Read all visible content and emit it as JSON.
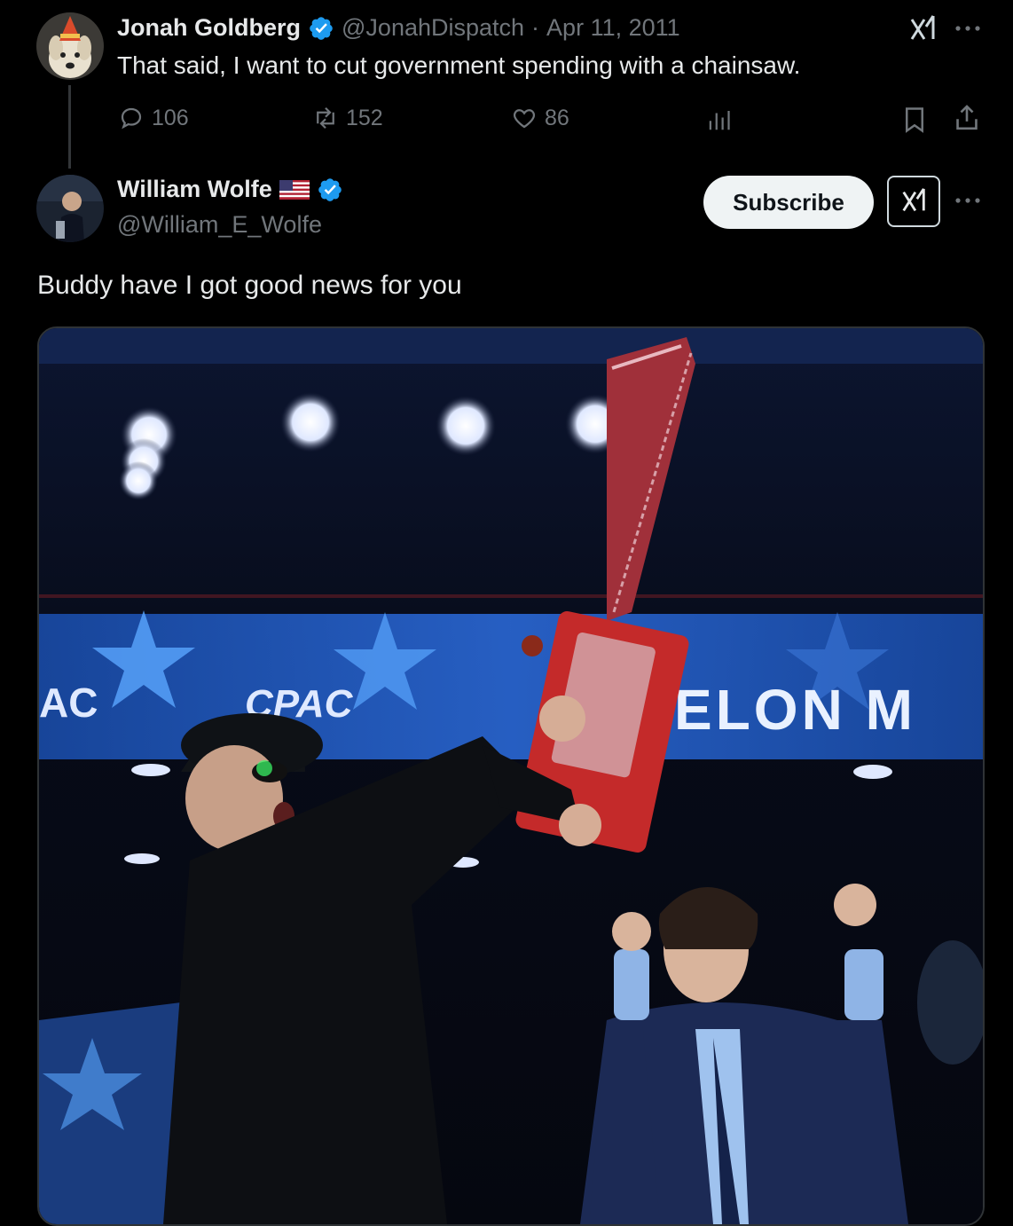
{
  "tweet1": {
    "author_name": "Jonah Goldberg",
    "handle": "@JonahDispatch",
    "separator": "·",
    "date": "Apr 11, 2011",
    "text": "That said, I want to cut government spending with a chainsaw.",
    "replies": "106",
    "retweets": "152",
    "likes": "86",
    "icons": [
      "grok-icon",
      "more-icon",
      "reply-icon",
      "retweet-icon",
      "like-icon",
      "views-icon",
      "bookmark-icon",
      "share-icon"
    ]
  },
  "tweet2": {
    "author_name": "William Wolfe",
    "flag": "us-flag-icon",
    "handle": "@William_E_Wolfe",
    "subscribe_label": "Subscribe",
    "text": "Buddy have I got good news for you",
    "banner_left_text": "AC",
    "banner_logo_text": "CPAC",
    "banner_right_text": "ELON M"
  },
  "colors": {
    "background": "#000000",
    "text_primary": "#e7e9ea",
    "text_muted": "#71767b",
    "verified_blue": "#1d9bf0",
    "subscribe_bg": "#eff3f4"
  }
}
